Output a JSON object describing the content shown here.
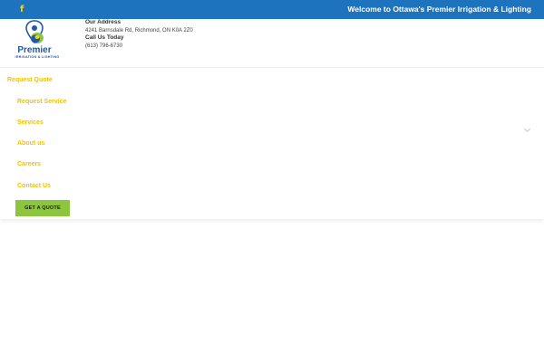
{
  "topbar": {
    "facebook_icon": "f",
    "welcome_text": "Welcome to Ottawa's Premier Irrigation & Lighting"
  },
  "logo": {
    "name": "Premier",
    "tagline": "IRRIGATION & LIGHTING"
  },
  "contact": {
    "address_label": "Our Address",
    "address": "4241 Barnsdale Rd, Richmond, ON K0A 2Z0",
    "phone_label": "Call Us Today",
    "phone": "(613) 796-6730"
  },
  "nav": {
    "items": [
      {
        "label": "Request Quote"
      },
      {
        "label": "Request Service"
      },
      {
        "label": "Services"
      },
      {
        "label": "About us"
      },
      {
        "label": "Careers"
      },
      {
        "label": "Contact Us"
      }
    ],
    "cta_label": "GET A QUOTE"
  },
  "colors": {
    "topbar": "#1e73be",
    "menu_text": "#f2c200",
    "cta": "#8cc63f",
    "logo_blue": "#1e5aa8"
  }
}
